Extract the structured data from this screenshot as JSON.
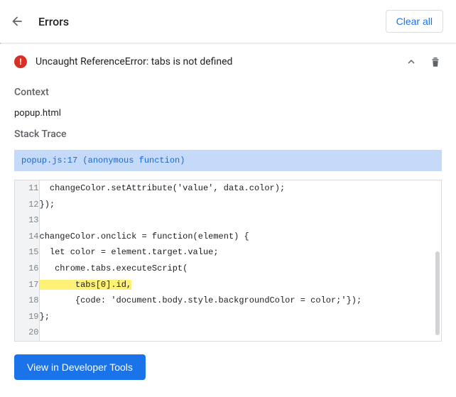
{
  "header": {
    "title": "Errors",
    "clear_label": "Clear all"
  },
  "error": {
    "badge_glyph": "!",
    "title": "Uncaught ReferenceError: tabs is not defined",
    "context_label": "Context",
    "context_value": "popup.html",
    "stack_label": "Stack Trace",
    "stack_header": "popup.js:17 (anonymous function)",
    "code_lines": [
      {
        "n": 11,
        "text": "  changeColor.setAttribute('value', data.color);",
        "hl": false
      },
      {
        "n": 12,
        "text": "});",
        "hl": false
      },
      {
        "n": 13,
        "text": "",
        "hl": false
      },
      {
        "n": 14,
        "text": "changeColor.onclick = function(element) {",
        "hl": false
      },
      {
        "n": 15,
        "text": "  let color = element.target.value;",
        "hl": false
      },
      {
        "n": 16,
        "text": "   chrome.tabs.executeScript(",
        "hl": false
      },
      {
        "n": 17,
        "text": "       tabs[0].id,",
        "hl": true
      },
      {
        "n": 18,
        "text": "       {code: 'document.body.style.backgroundColor = color;'});",
        "hl": false
      },
      {
        "n": 19,
        "text": "};",
        "hl": false
      },
      {
        "n": 20,
        "text": "",
        "hl": false
      }
    ]
  },
  "view_button_label": "View in Developer Tools"
}
